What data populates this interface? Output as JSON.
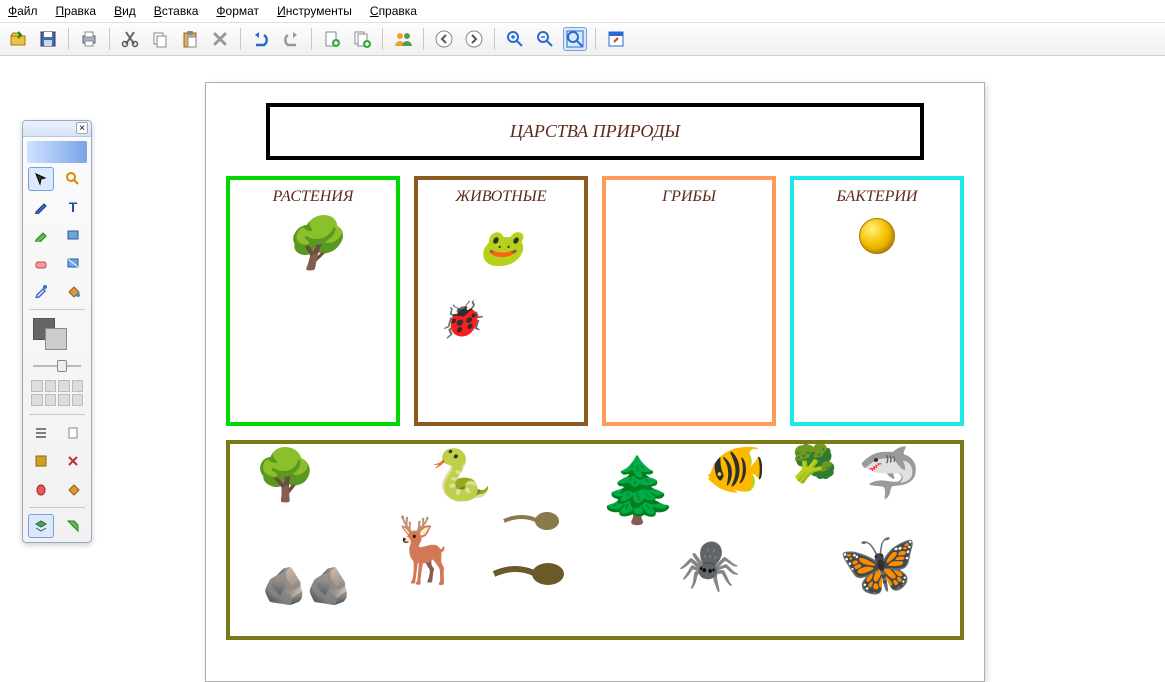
{
  "menu": {
    "file": "Файл",
    "edit": "Правка",
    "view": "Вид",
    "insert": "Вставка",
    "format": "Формат",
    "tools": "Инструменты",
    "help": "Справка"
  },
  "document": {
    "title": "ЦАРСТВА ПРИРОДЫ",
    "categories": {
      "plants": "РАСТЕНИЯ",
      "animals": "ЖИВОТНЫЕ",
      "fungi": "ГРИБЫ",
      "bacteria": "БАКТЕРИИ"
    }
  }
}
